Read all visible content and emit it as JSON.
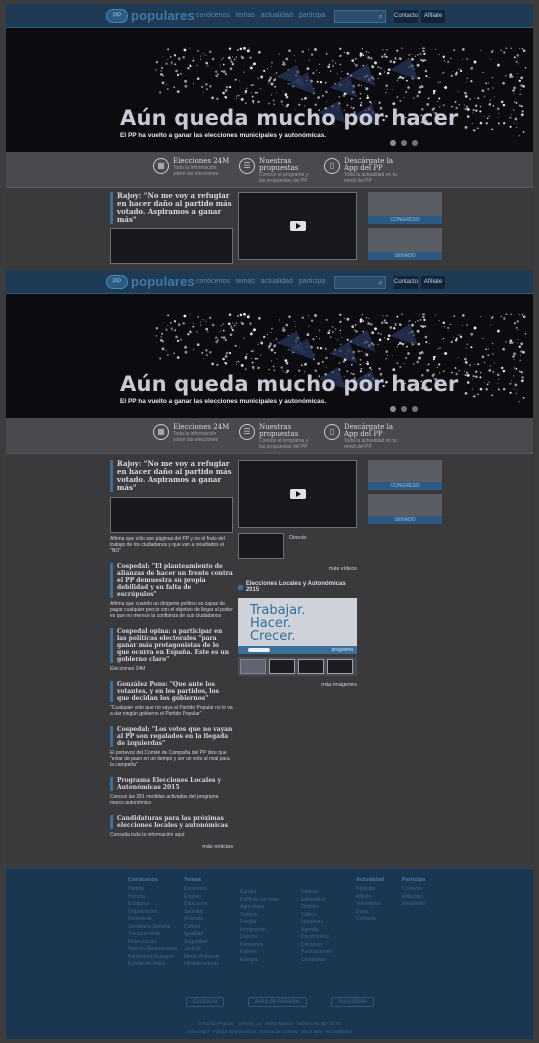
{
  "nav": {
    "logo_word": "populares",
    "logo_mark": "PP",
    "menu": [
      "conócenos",
      "temas",
      "actualidad",
      "participa"
    ],
    "contact_label": "Contacto",
    "join_label": "Afíliate"
  },
  "hero": {
    "title": "Aún queda mucho por hacer",
    "subtitle": "El PP ha vuelto a ganar las elecciones municipales y autonómicas."
  },
  "features": [
    {
      "icon": "calendar-icon",
      "glyph": "▦",
      "title": "Elecciones 24M",
      "desc": "Toda la información sobre las elecciones"
    },
    {
      "icon": "document-icon",
      "glyph": "☰",
      "title": "Nuestras propuestas",
      "desc": "Conoce el programa y las propuestas del PP"
    },
    {
      "icon": "mobile-icon",
      "glyph": "▯",
      "title": "Descárgate la App del PP",
      "desc": "Toda la actualidad en tu móvil del PP"
    }
  ],
  "news": {
    "lead_headline": "Rajoy: \"No me voy a refugiar en hacer daño al partido más votado. Aspiramos a ganar más\"",
    "lead_text": "Afirma que sólo son páginas del PP y no el fruto del trabajo de los ciudadanos y que van a resultados el \"NO\"",
    "items": [
      {
        "headline": "Cospedal: \"El planteamiento de alianzas de hacer un frente contra el PP demuestra su propia debilidad y su falta de escrúpulos\"",
        "text": "Afirma que cuando un dirigente político es capaz de pagar cualquier precio con el objetivo de llegar al poder es que no merece la confianza de sus ciudadanos"
      },
      {
        "headline": "Cospedal opina: a participar en las políticas electorales \"para ganar más protagonistas de lo que ocurra en España. Este es un gobierno claro\"",
        "text": "Elecciones 24M"
      },
      {
        "headline": "González Pons: \"Que ante los votantes, y en los partidos, los que decidan los gobiernos\"",
        "text": "\"Cualquier voto que no vaya al Partido Popular no lo va a dar ningún gobierno el Partido Popular\""
      },
      {
        "headline": "Cospedal: \"Los votos que no vayan al PP son regalados en la llegada de izquierdas\"",
        "text": "El portavoz del Comité de Campaña del PP dice que \"estar de paso en un tiempo y ser un voto al rival para la campaña\""
      },
      {
        "headline": "Programa Elecciones Locales y Autonómicas 2015",
        "text": "Conoce las 281 medidas activadas del programa marco autonómico"
      },
      {
        "headline": "Candidaturas para las próximas elecciones locales y autonómicas",
        "text": "Consulta toda la información aquí"
      }
    ],
    "more_news": "más noticias"
  },
  "media": {
    "video_caption": "Directo",
    "more_videos": "más vídeos",
    "section_title": "Elecciones Locales y Autonómicas 2015",
    "banner_lines": [
      "Trabajar.",
      "Hacer.",
      "Crecer."
    ],
    "banner_link": "programa",
    "more_images": "más imágenes"
  },
  "sidebar": {
    "box1_label": "CONGRESO",
    "box2_label": "SENADO"
  },
  "footer": {
    "columns": [
      {
        "title": "Conócenos",
        "items": [
          "Partido",
          "Historia",
          "Estatutos",
          "Organización",
          "Presidente",
          "Secretaría General",
          "Transparencia",
          "Financiación",
          "Nuevas Generaciones",
          "Parlamento Europeo",
          "Fundación FAES"
        ]
      },
      {
        "title": "Temas",
        "items": [
          "Economía",
          "Empleo",
          "Educación",
          "Sanidad",
          "Vivienda",
          "Cultura",
          "Igualdad",
          "Seguridad",
          "Justicia",
          "Medio Ambiente",
          "Infraestructuras"
        ]
      },
      {
        "title": "",
        "items": [
          "Europa",
          "Políticas Sociales",
          "Agricultura",
          "Turismo",
          "Familia",
          "Inmigración",
          "Deporte",
          "Pensiones",
          "Exterior",
          "Energía"
        ]
      },
      {
        "title": "",
        "items": [
          "Noticias",
          "Entrevistas",
          "Opinión",
          "Vídeos",
          "Imágenes",
          "Agenda",
          "Documentos",
          "Discursos",
          "Publicaciones",
          "Campañas"
        ]
      },
      {
        "title": "Actualidad",
        "items": [
          "Participa",
          "Afíliate",
          "Voluntarios",
          "Dona",
          "Contacto"
        ]
      },
      {
        "title": "Participa",
        "items": [
          "Contacto",
          "Afiliación",
          "Newsletter"
        ]
      }
    ],
    "buttons": [
      "Contacto",
      "Área de Afiliados",
      "Suscríbete"
    ],
    "legal_1": "© Partido Popular  ·  Génova, 13  ·  28004 Madrid  ·  Teléfono 91 557 73 00",
    "legal_2": "Aviso legal  ·  Política de privacidad  ·  Política de cookies  ·  Mapa web  ·  Accesibilidad"
  },
  "colors": {
    "nav": "#1e3a55",
    "accent": "#3d6f99",
    "footer": "#1b3651",
    "body": "#3a3a3d"
  }
}
